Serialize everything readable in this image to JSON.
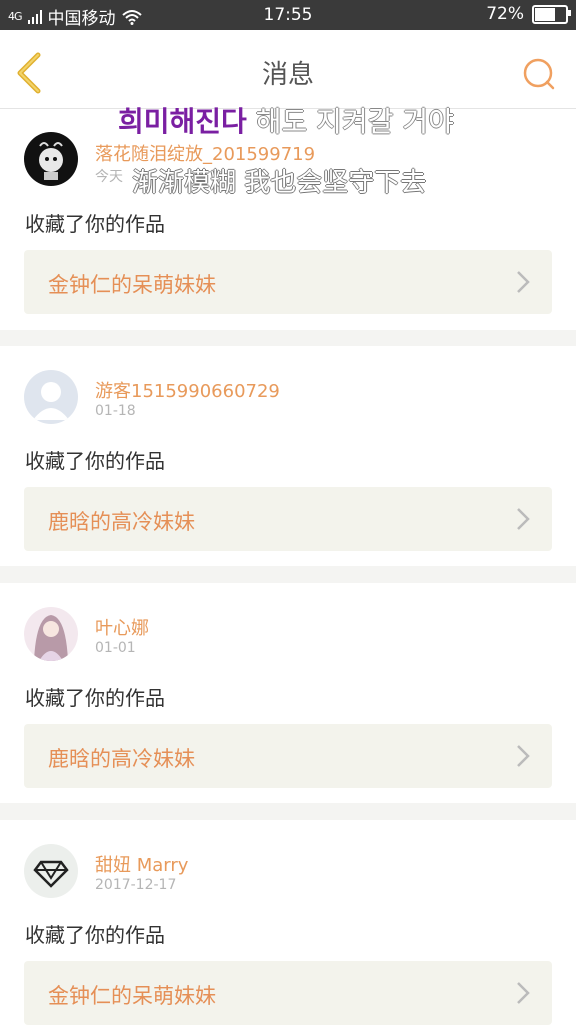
{
  "status_bar": {
    "signal_badge": "4G",
    "carrier": "中国移动",
    "time": "17:55",
    "battery_percent": "72%",
    "battery_level": 0.72
  },
  "navbar": {
    "title": "消息",
    "accent_color": "#f0a060"
  },
  "overlay": {
    "korean_part1": "희미해진다",
    "korean_part2": " 해도 지켜갈 거야",
    "chinese": "渐渐模糊 我也会坚守下去"
  },
  "messages": [
    {
      "user": "落花随泪绽放_201599719",
      "time": "今天",
      "action": "收藏了你的作品",
      "work": "金钟仁的呆萌妹妹"
    },
    {
      "user": "游客1515990660729",
      "time": "01-18",
      "action": "收藏了你的作品",
      "work": "鹿晗的高冷妹妹"
    },
    {
      "user": "叶心娜",
      "time": "01-01",
      "action": "收藏了你的作品",
      "work": "鹿晗的高冷妹妹"
    },
    {
      "user": "甜妞  Marry",
      "time": "2017-12-17",
      "action": "收藏了你的作品",
      "work": "金钟仁的呆萌妹妹"
    }
  ]
}
